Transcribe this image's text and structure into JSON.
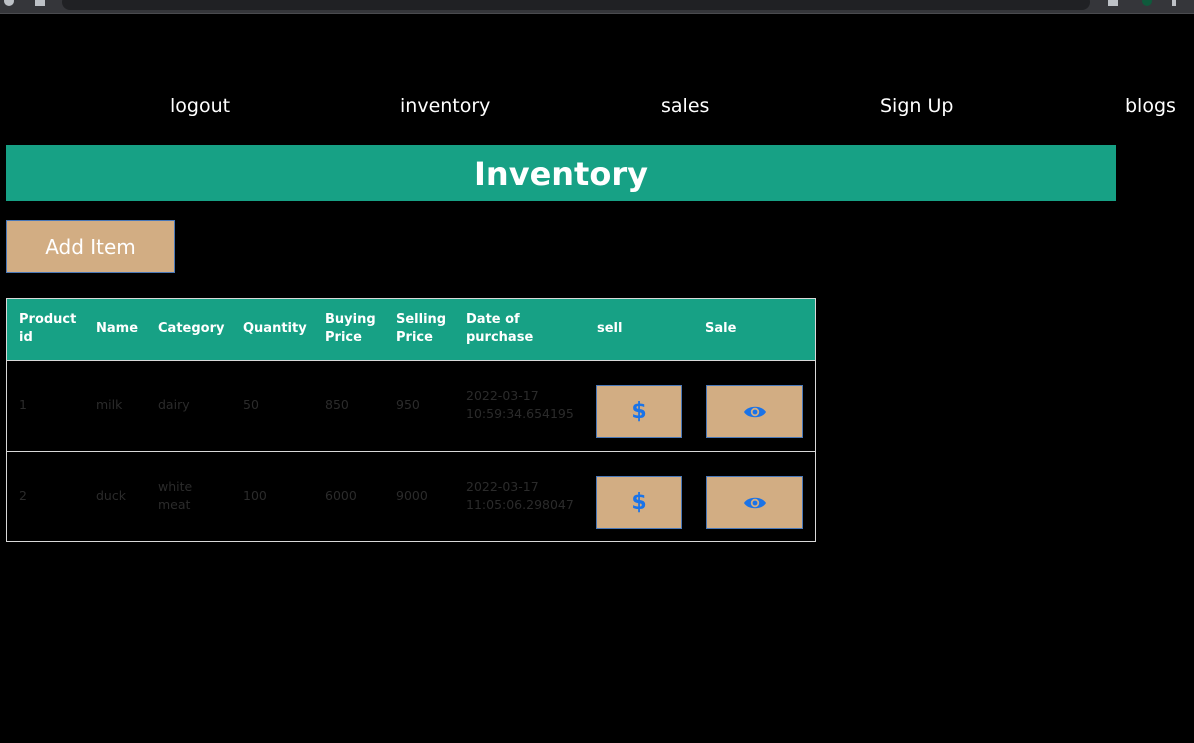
{
  "nav": {
    "items": [
      {
        "label": "logout"
      },
      {
        "label": "inventory"
      },
      {
        "label": "sales"
      },
      {
        "label": "Sign Up"
      },
      {
        "label": "blogs"
      }
    ]
  },
  "page": {
    "title": "Inventory",
    "add_item_label": "Add Item"
  },
  "table": {
    "headers": [
      "Product id",
      "Name",
      "Category",
      "Quantity",
      "Buying Price",
      "Selling Price",
      "Date of purchase",
      "sell",
      "Sale"
    ],
    "rows": [
      {
        "id": "1",
        "name": "milk",
        "category": "dairy",
        "quantity": "50",
        "buying_price": "850",
        "selling_price": "950",
        "date_line1": "2022-03-17",
        "date_line2": "10:59:34.654195",
        "sell_icon": "dollar-icon",
        "sale_icon": "eye-icon"
      },
      {
        "id": "2",
        "name": "duck",
        "category_line1": "white",
        "category_line2": "meat",
        "quantity": "100",
        "buying_price": "6000",
        "selling_price": "9000",
        "date_line1": "2022-03-17",
        "date_line2": "11:05:06.298047",
        "sell_icon": "dollar-icon",
        "sale_icon": "eye-icon"
      }
    ]
  },
  "colors": {
    "background": "#000000",
    "accent_teal": "#17a185",
    "button_tan": "#d2ad83",
    "icon_blue": "#1a73e8"
  }
}
